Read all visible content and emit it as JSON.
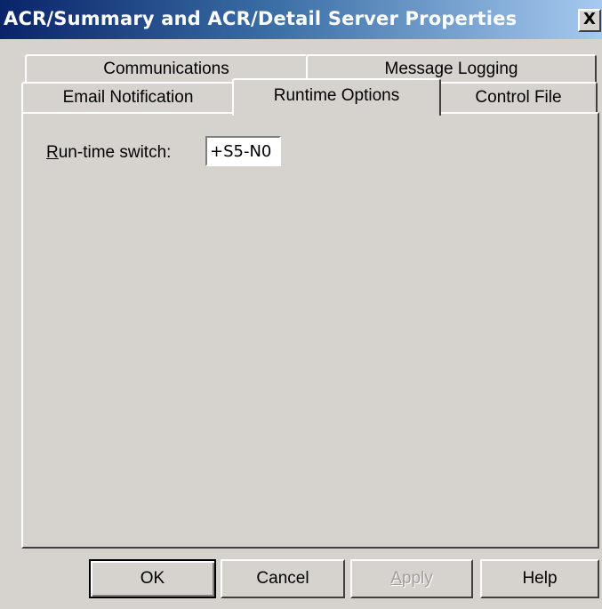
{
  "window": {
    "title": "ACR/Summary and ACR/Detail Server Properties",
    "close_label": "X"
  },
  "tabs": {
    "row1": [
      {
        "label": "Communications"
      },
      {
        "label": "Message Logging"
      }
    ],
    "row2": [
      {
        "label": "Email Notification"
      },
      {
        "label": "Runtime Options"
      },
      {
        "label": "Control File"
      }
    ],
    "active": "Runtime Options"
  },
  "runtime": {
    "switch_label_mnemonic": "R",
    "switch_label_rest": "un-time switch:",
    "switch_value": "+S5-N0"
  },
  "buttons": {
    "ok": "OK",
    "cancel": "Cancel",
    "apply_mnemonic": "A",
    "apply_rest": "pply",
    "help": "Help"
  },
  "colors": {
    "face": "#d6d3ce",
    "title_start": "#0a246a",
    "title_end": "#a6caf0"
  }
}
